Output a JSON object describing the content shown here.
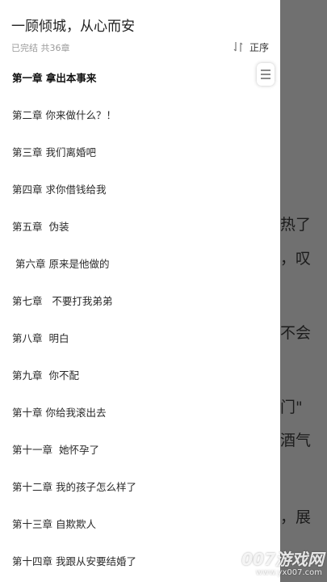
{
  "book": {
    "title": "一顾倾城，从心而安",
    "meta": "已完结 共36章"
  },
  "sort": {
    "label": "正序"
  },
  "chapters": [
    "第一章 拿出本事来",
    "第二章 你来做什么？！",
    "第三章 我们离婚吧",
    "第四章 求你借钱给我",
    "第五章  伪装",
    " 第六章 原来是他做的",
    "第七章   不要打我弟弟",
    "第八章  明白",
    "第九章  你不配",
    "第十章 你给我滚出去",
    "第十一章  她怀孕了",
    "第十二章 我的孩子怎么样了",
    "第十三章 自欺欺人",
    "第十四章 我跟从安要结婚了"
  ],
  "current_chapter_index": 0,
  "reader_fragments": [
    "热了",
    "，叹",
    "不会",
    "门\"",
    "酒气",
    "，展"
  ],
  "watermark": {
    "main": "007游戏网",
    "url": "www.yx007.com"
  },
  "colors": {
    "overlay": "#707070",
    "drawer_bg": "#ffffff",
    "text": "#2a2a2a",
    "muted": "#9a9a9a"
  }
}
